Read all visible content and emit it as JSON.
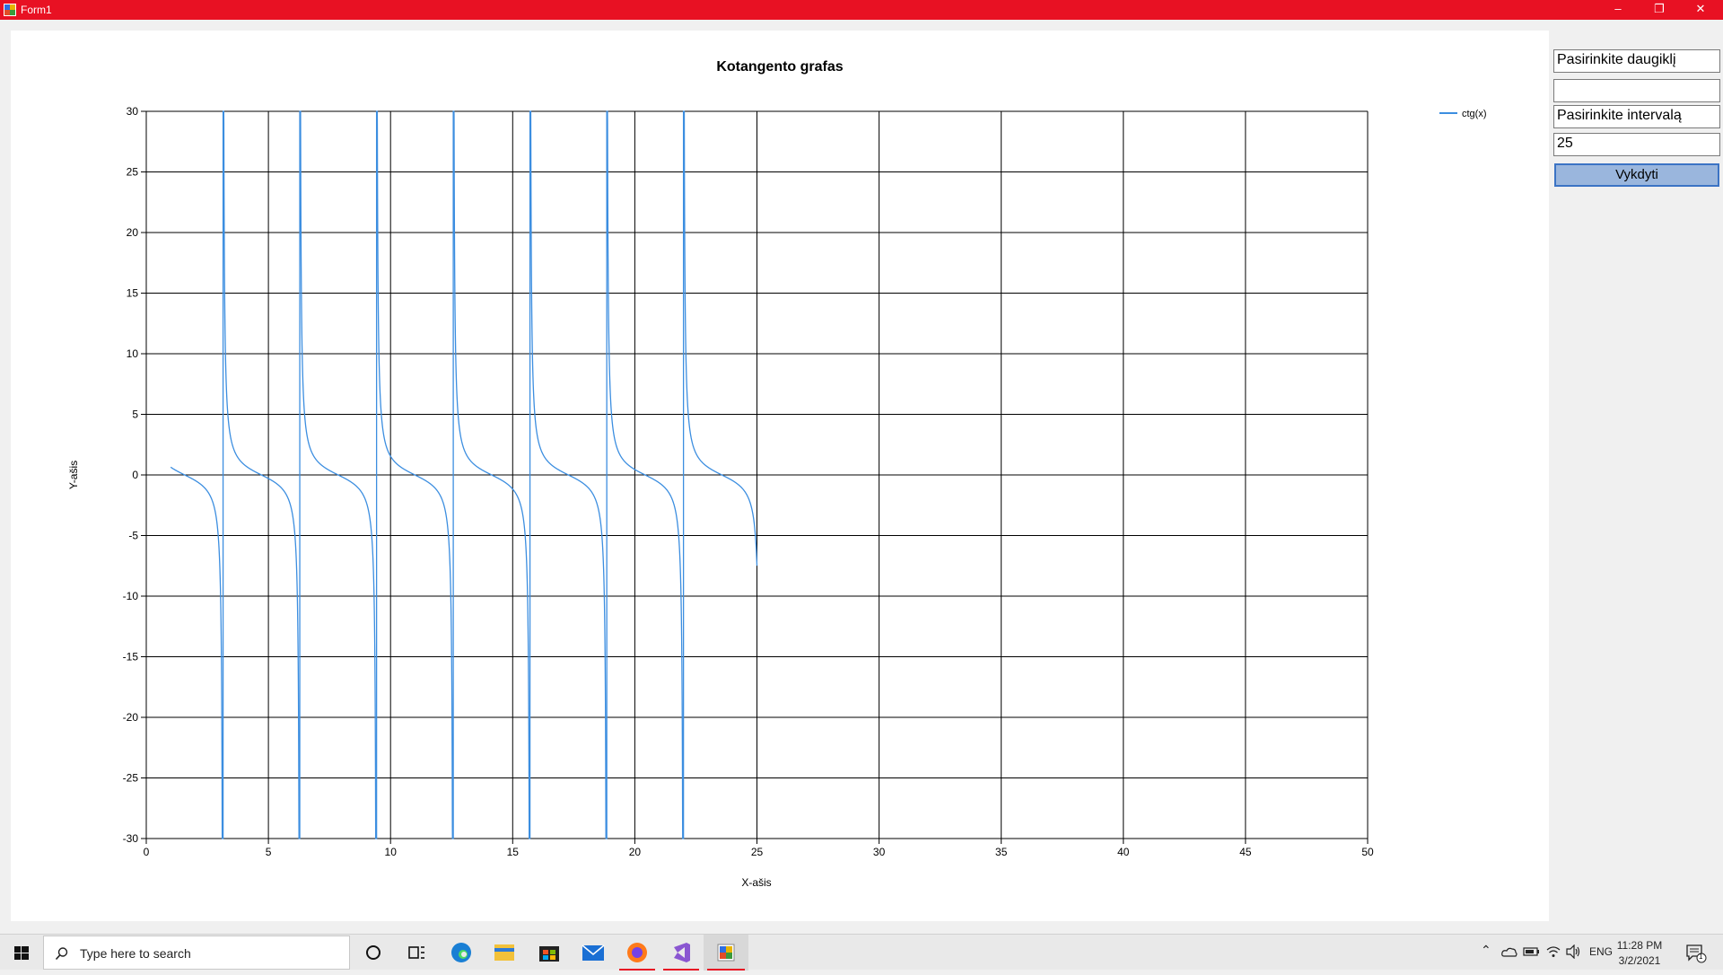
{
  "window": {
    "title": "Form1",
    "minimize_glyph": "–",
    "restore_glyph": "❐",
    "close_glyph": "✕"
  },
  "controls": {
    "multiplier_label": "Pasirinkite daugiklį",
    "multiplier_value": "",
    "interval_label": "Pasirinkite intervalą",
    "interval_value": "25",
    "run_button": "Vykdyti"
  },
  "chart_data": {
    "type": "line",
    "title": "Kotangento grafas",
    "xlabel": "X-ašis",
    "ylabel": "Y-ašis",
    "xlim": [
      0,
      50
    ],
    "ylim": [
      -30,
      30
    ],
    "x_ticks": [
      0,
      5,
      10,
      15,
      20,
      25,
      30,
      35,
      40,
      45,
      50
    ],
    "y_ticks": [
      30,
      25,
      20,
      15,
      10,
      5,
      0,
      -5,
      -10,
      -15,
      -20,
      -25,
      -30
    ],
    "grid": true,
    "legend_position": "top-right",
    "series": [
      {
        "name": "ctg(x)",
        "color": "#3c8ee0",
        "function": "cot(x)",
        "x_range": [
          1,
          25
        ]
      }
    ]
  },
  "taskbar": {
    "search_placeholder": "Type here to search",
    "language": "ENG",
    "time": "11:28 PM",
    "date": "3/2/2021",
    "notification_count": "1",
    "icons": [
      "windows-start-icon",
      "search-icon",
      "cortana-icon",
      "task-view-icon",
      "edge-icon",
      "file-explorer-icon",
      "store-icon",
      "mail-icon",
      "firefox-icon",
      "visual-studio-icon",
      "form-app-icon"
    ]
  }
}
